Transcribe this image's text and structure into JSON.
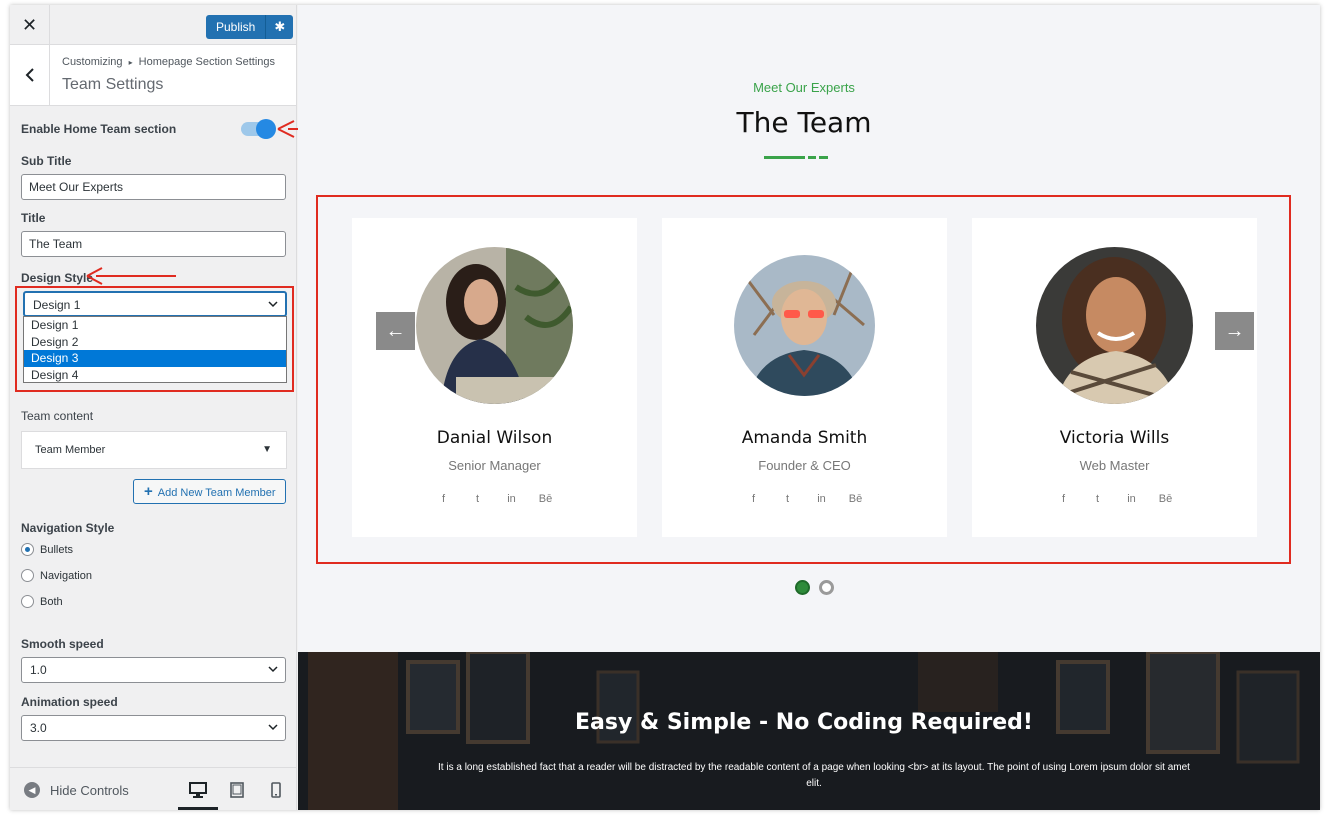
{
  "sidebar": {
    "close_icon": "close-icon",
    "publish_label": "Publish",
    "breadcrumb_root": "Customizing",
    "breadcrumb_sep": "▸",
    "breadcrumb_parent": "Homepage Section Settings",
    "section_title": "Team Settings",
    "enable_label": "Enable Home Team section",
    "enable_value": true,
    "subtitle_label": "Sub Title",
    "subtitle_value": "Meet Our Experts",
    "title_label": "Title",
    "title_value": "The Team",
    "design_label": "Design Style",
    "design_value": "Design 1",
    "design_options": [
      "Design 1",
      "Design 2",
      "Design 3",
      "Design 4"
    ],
    "design_highlighted": "Design 3",
    "team_content_label": "Team content",
    "team_content_value": "Team Member",
    "add_member_label": "Add New Team Member",
    "nav_style_label": "Navigation Style",
    "nav_options": [
      "Bullets",
      "Navigation",
      "Both"
    ],
    "nav_selected": "Bullets",
    "smooth_label": "Smooth speed",
    "smooth_value": "1.0",
    "anim_label": "Animation speed",
    "anim_value": "3.0",
    "hide_controls": "Hide Controls"
  },
  "preview": {
    "subtitle": "Meet Our Experts",
    "title": "The Team",
    "members": [
      {
        "name": "Danial Wilson",
        "role": "Senior Manager"
      },
      {
        "name": "Amanda Smith",
        "role": "Founder & CEO"
      },
      {
        "name": "Victoria Wills",
        "role": "Web Master"
      }
    ],
    "social_icons": [
      "f",
      "t",
      "in",
      "Bē"
    ],
    "prev_arrow": "←",
    "next_arrow": "→",
    "cta_title": "Easy & Simple - No Coding Required!",
    "cta_text": "It is a long established fact that a reader will be distracted by the readable content of a page when looking <br> at its layout. The point of using Lorem ipsum dolor sit amet elit."
  },
  "colors": {
    "accent_green": "#3aa34a",
    "wp_blue": "#2271b1",
    "highlight_red": "#e02b20"
  }
}
